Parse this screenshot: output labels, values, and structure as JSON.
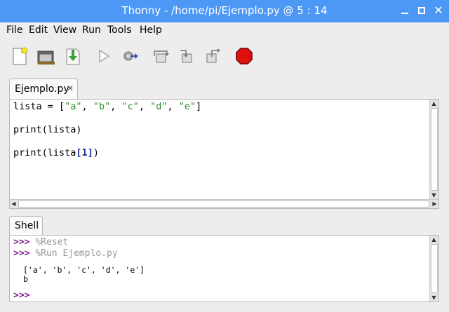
{
  "window": {
    "title": "Thonny  -  /home/pi/Ejemplo.py  @  5 : 14",
    "close_glyph": "✕"
  },
  "menu": [
    "File",
    "Edit",
    "View",
    "Run",
    "Tools",
    "Help"
  ],
  "toolbar": {
    "icons": [
      "new-file-icon",
      "open-folder-icon",
      "save-icon",
      "run-icon",
      "debug-icon",
      "step-over-icon",
      "step-into-icon",
      "step-out-icon",
      "stop-icon"
    ]
  },
  "editor": {
    "tab_label": "Ejemplo.py",
    "tab_close": "✕",
    "lines": [
      {
        "plain": "lista = [",
        "s1": "\"a\"",
        "s2": "\"b\"",
        "s3": "\"c\"",
        "s4": "\"d\"",
        "s5": "\"e\"",
        "end": "]"
      },
      {
        "text": "print(lista)"
      },
      {
        "pre": "print(lista",
        "open": "[",
        "num": "1",
        "close": "]",
        "post": ")"
      }
    ]
  },
  "shell": {
    "tab_label": "Shell",
    "prompt": ">>>",
    "cmd1": "%Reset",
    "cmd2": "%Run Ejemplo.py",
    "output1": "['a', 'b', 'c', 'd', 'e']",
    "output2": "b"
  },
  "colors": {
    "titlebar": "#4d98f5",
    "string": "#2a8e2a",
    "prompt": "#7e1a8e",
    "stop": "#e01010"
  }
}
